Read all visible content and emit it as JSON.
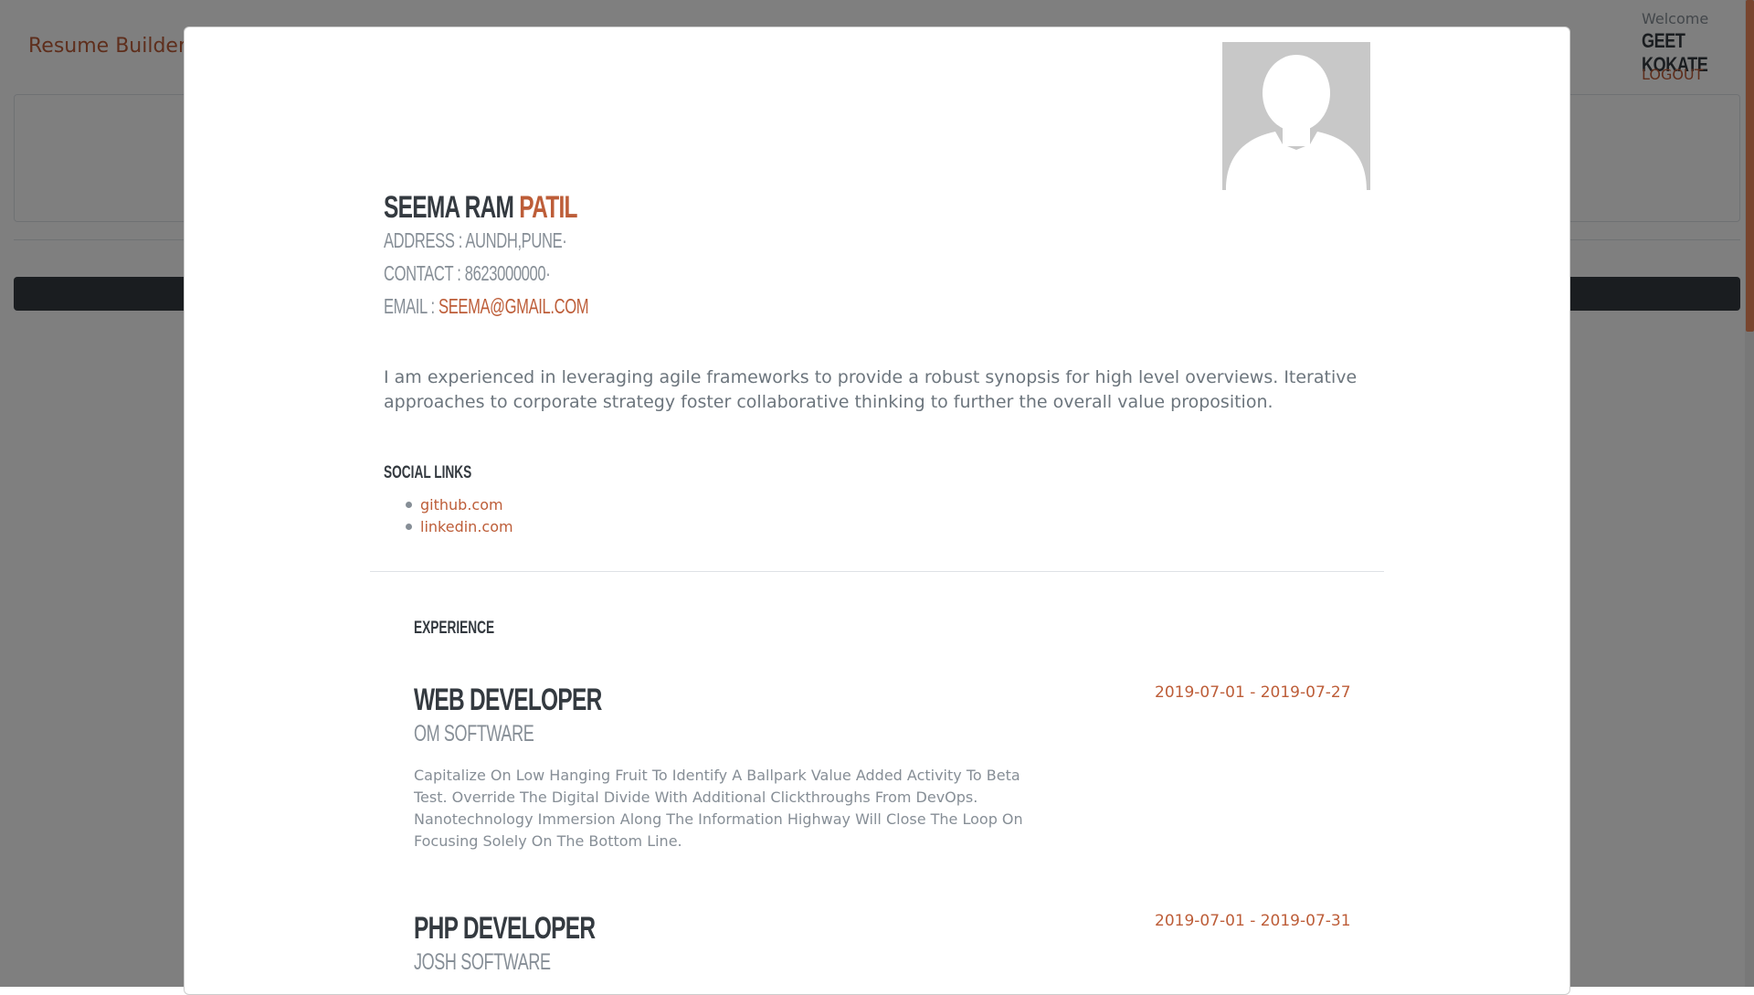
{
  "navbar": {
    "brand": "Resume Builder",
    "welcome_label": "Welcome",
    "user_name": "GEET KOKATE",
    "logout_label": "LOGOUT"
  },
  "resume": {
    "first_middle_name": "SEEMA RAM",
    "last_name": "PATIL",
    "address_label": "ADDRESS  :",
    "address_value": "AUNDH,PUNE·",
    "contact_label": "CONTACT  :",
    "contact_value": "8623000000·",
    "email_label": "EMAIL  :",
    "email_value": "SEEMA@GMAIL.COM",
    "summary": "I am experienced in leveraging agile frameworks to provide a robust synopsis for high level overviews. Iterative approaches to corporate strategy foster collaborative thinking to further the overall value proposition.",
    "social_heading": "SOCIAL LINKS",
    "social_links": [
      "github.com",
      "linkedin.com"
    ],
    "experience_heading": "EXPERIENCE",
    "experience": [
      {
        "title": "WEB DEVELOPER",
        "company": "OM SOFTWARE",
        "dates": "2019-07-01 - 2019-07-27",
        "description": "Capitalize On Low Hanging Fruit To Identify A Ballpark Value Added Activity To Beta Test. Override The Digital Divide With Additional Clickthroughs From DevOps. Nanotechnology Immersion Along The Information Highway Will Close The Loop On Focusing Solely On The Bottom Line."
      },
      {
        "title": "PHP DEVELOPER",
        "company": "JOSH SOFTWARE",
        "dates": "2019-07-01 - 2019-07-31",
        "description": ""
      }
    ]
  },
  "colors": {
    "accent": "#bd5d38",
    "dark": "#343a40",
    "muted": "#868e96"
  },
  "icons": {
    "avatar": "user-silhouette-icon",
    "bullet": "bullet-dot-icon"
  }
}
